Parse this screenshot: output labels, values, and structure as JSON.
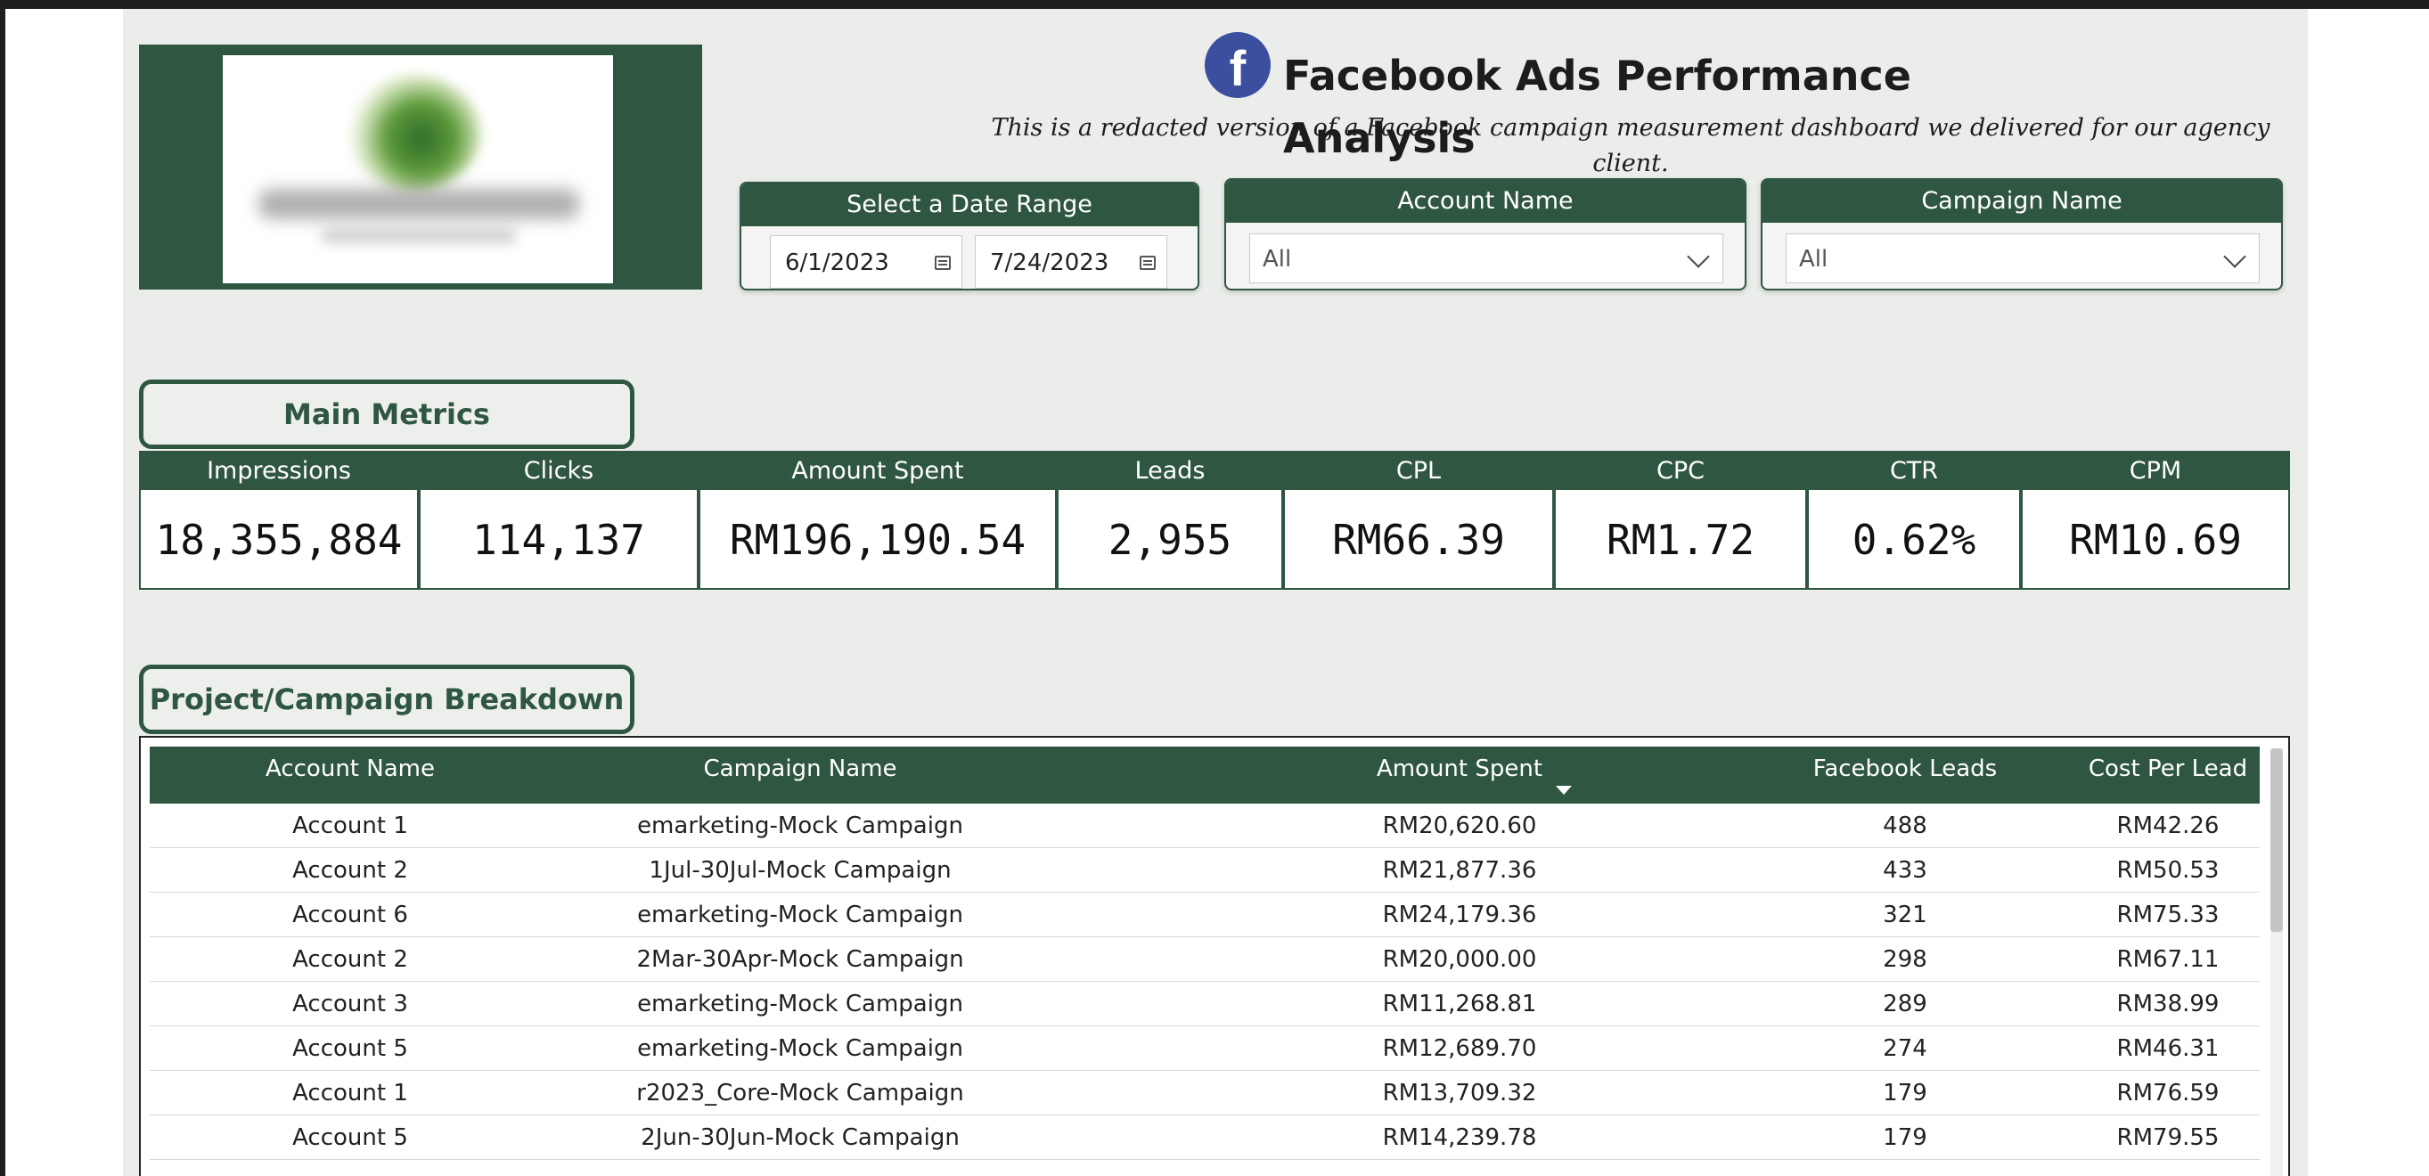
{
  "header": {
    "title": "Facebook Ads Performance Analysis",
    "subtitle": "This is a redacted version of a Facebook campaign measurement dashboard we delivered for our agency client.",
    "facebook_glyph": "f"
  },
  "filters": {
    "date_range": {
      "label": "Select a Date Range",
      "start": "6/1/2023",
      "end": "7/24/2023"
    },
    "account": {
      "label": "Account Name",
      "value": "All"
    },
    "campaign": {
      "label": "Campaign Name",
      "value": "All"
    }
  },
  "sections": {
    "main_metrics": "Main Metrics",
    "breakdown": "Project/Campaign Breakdown"
  },
  "metrics": [
    {
      "label": "Impressions",
      "value": "18,355,884"
    },
    {
      "label": "Clicks",
      "value": "114,137"
    },
    {
      "label": "Amount Spent",
      "value": "RM196,190.54"
    },
    {
      "label": "Leads",
      "value": "2,955"
    },
    {
      "label": "CPL",
      "value": "RM66.39"
    },
    {
      "label": "CPC",
      "value": "RM1.72"
    },
    {
      "label": "CTR",
      "value": "0.62%"
    },
    {
      "label": "CPM",
      "value": "RM10.69"
    }
  ],
  "table": {
    "columns": [
      "Account Name",
      "Campaign Name",
      "Amount Spent",
      "Facebook Leads",
      "Cost Per Lead"
    ],
    "sorted_column": "Amount Spent",
    "rows": [
      [
        "Account 1",
        "emarketing-Mock Campaign",
        "RM20,620.60",
        "488",
        "RM42.26"
      ],
      [
        "Account 2",
        "1Jul-30Jul-Mock Campaign",
        "RM21,877.36",
        "433",
        "RM50.53"
      ],
      [
        "Account 6",
        "emarketing-Mock Campaign",
        "RM24,179.36",
        "321",
        "RM75.33"
      ],
      [
        "Account 2",
        "2Mar-30Apr-Mock Campaign",
        "RM20,000.00",
        "298",
        "RM67.11"
      ],
      [
        "Account 3",
        "emarketing-Mock Campaign",
        "RM11,268.81",
        "289",
        "RM38.99"
      ],
      [
        "Account 5",
        "emarketing-Mock Campaign",
        "RM12,689.70",
        "274",
        "RM46.31"
      ],
      [
        "Account 1",
        "r2023_Core-Mock Campaign",
        "RM13,709.32",
        "179",
        "RM76.59"
      ],
      [
        "Account 5",
        "2Jun-30Jun-Mock Campaign",
        "RM14,239.78",
        "179",
        "RM79.55"
      ]
    ]
  },
  "colors": {
    "brand_green": "#2f5640",
    "canvas_bg": "#ebedeb",
    "facebook_blue": "#3b4f9e"
  }
}
